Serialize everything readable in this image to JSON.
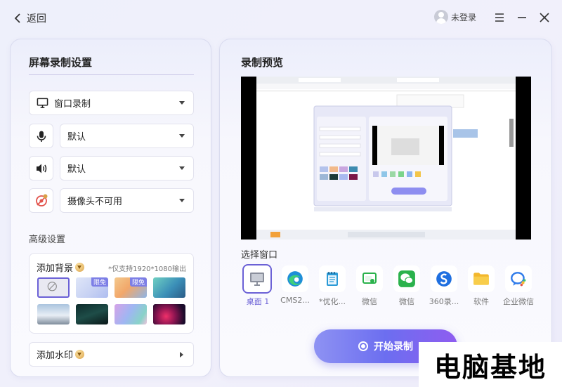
{
  "topbar": {
    "back_label": "返回",
    "user_label": "未登录"
  },
  "left": {
    "title": "屏幕录制设置",
    "source_select": "窗口录制",
    "mic_select": "默认",
    "speaker_select": "默认",
    "camera_select": "摄像头不可用",
    "advanced_label": "高级设置",
    "background": {
      "title": "添加背景",
      "note": "*仅支持1920*1080输出",
      "badges": [
        "限免",
        "限免"
      ]
    },
    "watermark_label": "添加水印"
  },
  "right": {
    "title": "录制预览",
    "choose_window_label": "选择窗口",
    "apps": [
      {
        "label": "桌面 1",
        "icon": "desktop-icon"
      },
      {
        "label": "CMS2...",
        "icon": "edge-browser-icon"
      },
      {
        "label": "*优化...",
        "icon": "notepad-icon"
      },
      {
        "label": "微信",
        "icon": "wechat-window-icon"
      },
      {
        "label": "微信",
        "icon": "wechat-icon"
      },
      {
        "label": "360录...",
        "icon": "360-recorder-icon"
      },
      {
        "label": "软件",
        "icon": "folder-icon"
      },
      {
        "label": "企业微信",
        "icon": "wecom-icon"
      }
    ],
    "start_label": "开始录制"
  },
  "overlay_watermark": "电脑基地",
  "colors": {
    "accent": "#6b61d6",
    "button_start": "#8e92f3",
    "button_end": "#8f5df0"
  }
}
